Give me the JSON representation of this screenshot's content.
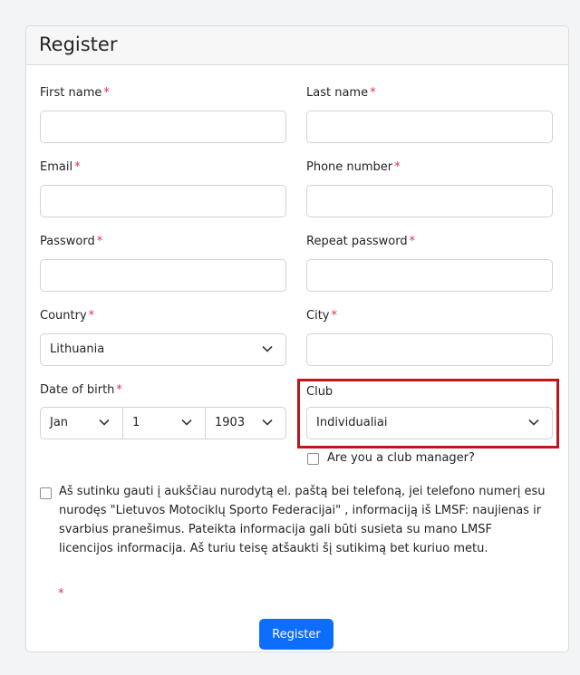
{
  "form": {
    "title": "Register",
    "required_mark": "*",
    "first_name": {
      "label": "First name",
      "value": ""
    },
    "last_name": {
      "label": "Last name",
      "value": ""
    },
    "email": {
      "label": "Email",
      "value": ""
    },
    "phone": {
      "label": "Phone number",
      "value": ""
    },
    "password": {
      "label": "Password",
      "value": ""
    },
    "repeat_password": {
      "label": "Repeat password",
      "value": ""
    },
    "country": {
      "label": "Country",
      "value": "Lithuania"
    },
    "city": {
      "label": "City",
      "value": ""
    },
    "dob": {
      "label": "Date of birth",
      "month": "Jan",
      "day": "1",
      "year": "1903"
    },
    "club": {
      "label": "Club",
      "value": "Individualiai",
      "manager_label": "Are you a club manager?"
    },
    "consent": {
      "text": "Aš sutinku gauti į aukščiau nurodytą el. paštą bei telefoną, jei telefono numerį esu nurodęs \"Lietuvos Motociklų Sporto Federacijai\" , informaciją iš LMSF: naujienas ir svarbius pranešimus. Pateikta informacija gali būti susieta su mano LMSF licencijos informacija. Aš turiu teisę atšaukti šį sutikimą bet kuriuo metu."
    },
    "submit_label": "Register"
  },
  "colors": {
    "primary": "#0d6efd",
    "required": "#dc3545",
    "highlight": "#c0151c"
  },
  "icons": {
    "select_arrow": "chevron-down-icon"
  }
}
